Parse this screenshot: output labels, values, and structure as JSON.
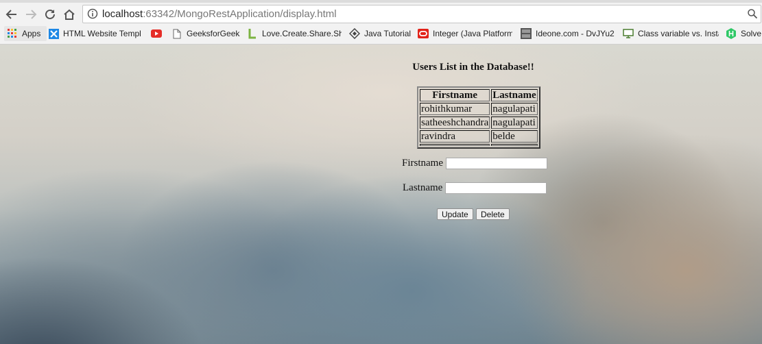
{
  "browser": {
    "url_host": "localhost",
    "url_rest": ":63342/MongoRestApplication/display.html",
    "bookmarks": [
      {
        "label": "Apps",
        "icon": "apps-grid-icon"
      },
      {
        "label": "HTML Website Templ",
        "icon": "html-template-icon"
      },
      {
        "label": "",
        "icon": "youtube-icon"
      },
      {
        "label": "GeeksforGeeks",
        "icon": "page-icon"
      },
      {
        "label": "Love.Create.Share.Sho",
        "icon": "l-logo-icon"
      },
      {
        "label": "Java Tutorial",
        "icon": "diamond-icon"
      },
      {
        "label": "Integer (Java Platform",
        "icon": "oracle-icon"
      },
      {
        "label": "Ideone.com - DvJYu2",
        "icon": "ideone-icon"
      },
      {
        "label": "Class variable vs. Insta",
        "icon": "desktop-icon"
      },
      {
        "label": "Solve",
        "icon": "hackerrank-icon"
      }
    ],
    "colors": {
      "youtube": "#e52d27",
      "oracle": "#e2231a",
      "hackerrank": "#2ec866",
      "l_logo": "#7cb342"
    }
  },
  "page": {
    "heading": "Users List in the Database!!",
    "table": {
      "headers": [
        "Firstname",
        "Lastname"
      ],
      "rows": [
        [
          "rohithkumar",
          "nagulapati"
        ],
        [
          "satheeshchandra",
          "nagulapati"
        ],
        [
          "ravindra",
          "belde"
        ]
      ]
    },
    "form": {
      "firstname_label": "Firstname",
      "firstname_value": "",
      "lastname_label": "Lastname",
      "lastname_value": "",
      "update_label": "Update",
      "delete_label": "Delete"
    }
  }
}
